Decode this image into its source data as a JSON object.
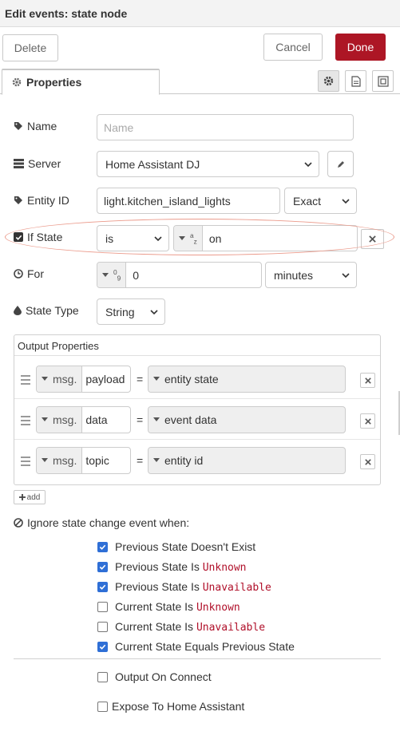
{
  "title": "Edit events: state node",
  "toolbar": {
    "delete_label": "Delete",
    "cancel_label": "Cancel",
    "done_label": "Done"
  },
  "tab": {
    "label": "Properties"
  },
  "fields": {
    "name": {
      "label": "Name",
      "placeholder": "Name"
    },
    "server": {
      "label": "Server",
      "value": "Home Assistant DJ"
    },
    "entity_id": {
      "label": "Entity ID",
      "value": "light.kitchen_island_lights",
      "match": "Exact"
    },
    "if_state": {
      "label": "If State",
      "operator": "is",
      "type_glyph": "a z",
      "value": "on",
      "checked": true
    },
    "for": {
      "label": "For",
      "type_glyph": "0 9",
      "value": "0",
      "unit": "minutes"
    },
    "state_type": {
      "label": "State Type",
      "value": "String"
    }
  },
  "output_properties": {
    "legend": "Output Properties",
    "rows": [
      {
        "prefix": "msg.",
        "key": "payload",
        "equals": "=",
        "value": "entity state"
      },
      {
        "prefix": "msg.",
        "key": "data",
        "equals": "=",
        "value": "event data"
      },
      {
        "prefix": "msg.",
        "key": "topic",
        "equals": "=",
        "value": "entity id"
      }
    ],
    "add_label": "add"
  },
  "ignore": {
    "heading": "Ignore state change event when:",
    "items": [
      {
        "text": "Previous State Doesn't Exist",
        "code": "",
        "checked": true
      },
      {
        "text": "Previous State Is ",
        "code": "Unknown",
        "checked": true
      },
      {
        "text": "Previous State Is ",
        "code": "Unavailable",
        "checked": true
      },
      {
        "text": "Current State Is ",
        "code": "Unknown",
        "checked": false
      },
      {
        "text": "Current State Is ",
        "code": "Unavailable",
        "checked": false
      },
      {
        "text": "Current State Equals Previous State",
        "code": "",
        "checked": true
      }
    ]
  },
  "extra": {
    "output_on_connect": {
      "label": "Output On Connect",
      "checked": false
    },
    "expose": {
      "label": "Expose To Home Assistant",
      "checked": false
    }
  },
  "colors": {
    "accent": "#ad1625",
    "checkbox": "#2f6fd6",
    "highlight": "#eb9b8c",
    "code": "#b0102a"
  }
}
